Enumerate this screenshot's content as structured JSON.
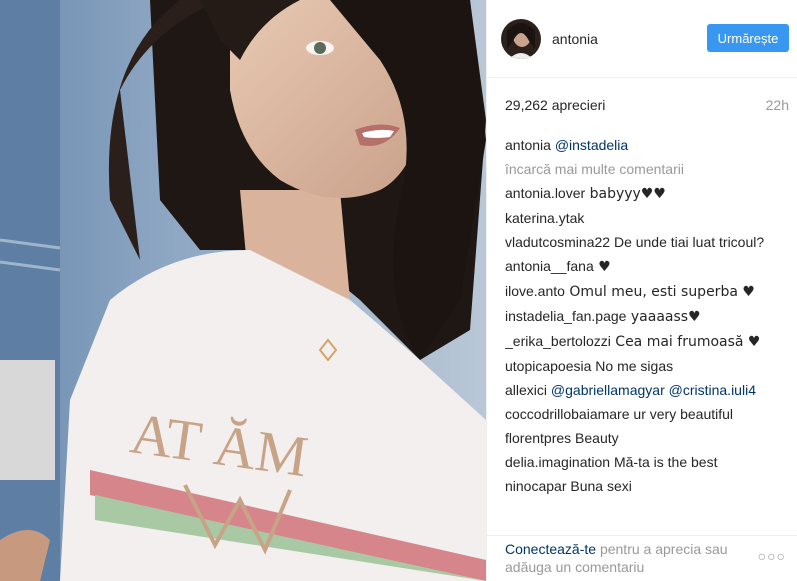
{
  "post": {
    "username": "antonia",
    "follow_label": "Urmărește",
    "likes": "29,262 aprecieri",
    "time": "22h"
  },
  "caption": {
    "user": "antonia",
    "emoji": "",
    "mention": "@instadelia"
  },
  "load_more": "încarcă mai multe comentarii",
  "comments": [
    {
      "user": "antonia.lover",
      "text": " babyyy♥♥"
    },
    {
      "user": "katerina.ytak",
      "text": " "
    },
    {
      "user": "vladutcosmina22",
      "text": " De unde tiai luat tricoul?"
    },
    {
      "user": "antonia__fana",
      "text": " ♥"
    },
    {
      "user": "ilove.anto",
      "text": " Omul meu, esti superba ♥"
    },
    {
      "user": "instadelia_fan.page",
      "text": " yaaaass♥"
    },
    {
      "user": "_erika_bertolozzi",
      "text": " Cea mai frumoasă ♥"
    },
    {
      "user": "utopicapoesia",
      "text": " No me sigas"
    },
    {
      "user": "allexici",
      "text": " ",
      "mention1": "@gabriellamagyar",
      "mention2": "@cristina.iuli4",
      "tail": " "
    },
    {
      "user": "coccodrillobaiamare",
      "text": " ur very beautiful"
    },
    {
      "user": "florentpres",
      "text": " Beauty "
    },
    {
      "user": "delia.imagination",
      "text": " Mă-ta is the best"
    },
    {
      "user": "ninocapar",
      "text": " Buna sexi"
    }
  ],
  "footer": {
    "login": "Conectează-te",
    "rest": " pentru a aprecia sau adăuga un comentariu",
    "more": "○○○"
  },
  "photo": {
    "shirt_text": "AT ĂM"
  }
}
